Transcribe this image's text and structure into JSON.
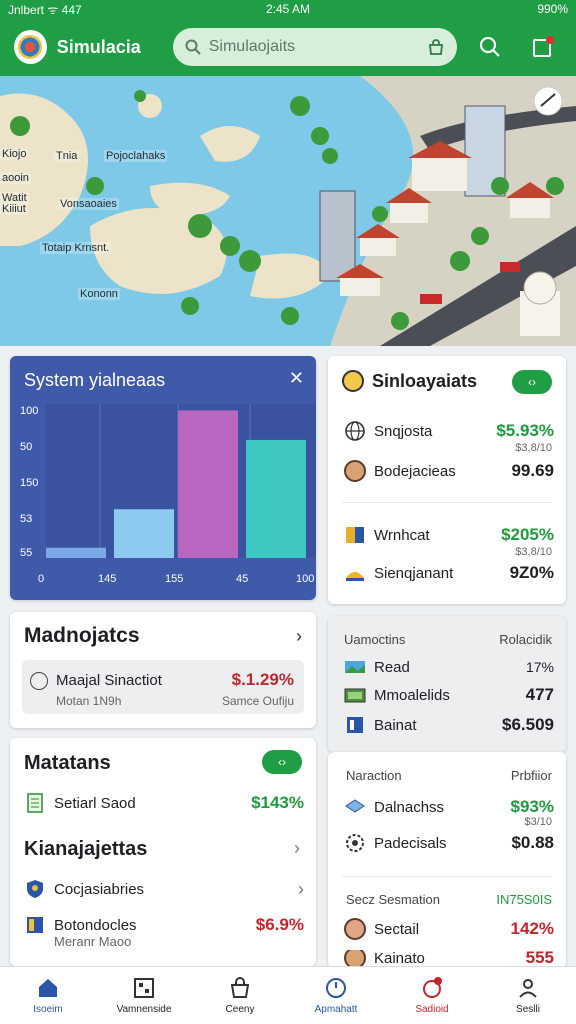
{
  "status": {
    "carrier": "Jnlbert ᯤ 447",
    "time": "2:45 AM",
    "battery": "990%"
  },
  "appbar": {
    "title": "Simulacia",
    "search_placeholder": "Simulaojaits"
  },
  "map": {
    "labels": [
      "Tnia",
      "Pojoclahaks",
      "aooin",
      "Watit",
      "Kiiiut",
      "Vonsaoaies",
      "Totaip Krnsnt.",
      "Kononn",
      "Kiojo"
    ]
  },
  "chart": {
    "title": "System yialneaas",
    "close": "✕",
    "chart_data": {
      "type": "bar",
      "y_tick_labels": [
        "100",
        "50",
        "150",
        "53",
        "55"
      ],
      "x_tick_labels": [
        "0",
        "145",
        "155",
        "45",
        "100"
      ],
      "values": [
        8,
        38,
        115,
        92
      ],
      "ylim": [
        0,
        120
      ],
      "colors": [
        "#7ea7e6",
        "#8ecaf0",
        "#b866bf",
        "#3ec8c2"
      ]
    }
  },
  "card_right_1": {
    "title": "Sinloayaiats",
    "pill": "‹›",
    "rows": [
      {
        "label": "Snqjosta",
        "value": "$5.93%",
        "sub": "$3,8/10"
      },
      {
        "label": "Bodejacieas",
        "value": "99.69"
      },
      {
        "label": "Wrnhcat",
        "value": "$205%",
        "sub": "$3,8/10"
      },
      {
        "label": "Sienqjanant",
        "value": "9Z0%"
      }
    ]
  },
  "card_mad": {
    "title": "Madnojatcs",
    "item": {
      "name": "Maajal Sinactiot",
      "sub": "Motan 1N9h",
      "value": "$.1.29%",
      "value_sub": "Samce Oufiju"
    }
  },
  "card_right_2": {
    "head_left": "Uamoctins",
    "head_right": "Rolacidik",
    "rows": [
      {
        "label": "Read",
        "value": "17%"
      },
      {
        "label": "Mmoalelids",
        "value": "477"
      },
      {
        "label": "Bainat",
        "value": "$6.509"
      }
    ]
  },
  "card_mat": {
    "title": "Matatans",
    "pill": "‹›",
    "row1": {
      "label": "Setiarl Saod",
      "value": "$143%"
    },
    "title2": "Kianajajettas",
    "row2": {
      "label": "Cocjasiabries"
    },
    "row3": {
      "label": "Botondocles",
      "sub": "Meranr Maoo",
      "value": "$6.9%"
    }
  },
  "card_right_3": {
    "head_left": "Naraction",
    "head_right": "Prbfiior",
    "rows": [
      {
        "label": "Dalnachss",
        "value": "$93%",
        "sub": "$3/10"
      },
      {
        "label": "Padecisals",
        "value": "$0.88"
      }
    ],
    "head2_left": "Secz Sesmation",
    "head2_right": "IN75S0IS",
    "rows2": [
      {
        "label": "Sectail",
        "value": "142%"
      },
      {
        "label": "Kainato",
        "value": "555"
      }
    ]
  },
  "bottom_nav": [
    {
      "label": "Isoeim"
    },
    {
      "label": "Vamnenside"
    },
    {
      "label": "Ceeny"
    },
    {
      "label": "Apmahatt"
    },
    {
      "label": "Sadioid"
    },
    {
      "label": "Seslli"
    }
  ],
  "colors": {
    "brand": "#1f9e45",
    "chart_bg": "#3f5aa8",
    "positive": "#1e9a3d",
    "negative": "#c0262b"
  }
}
